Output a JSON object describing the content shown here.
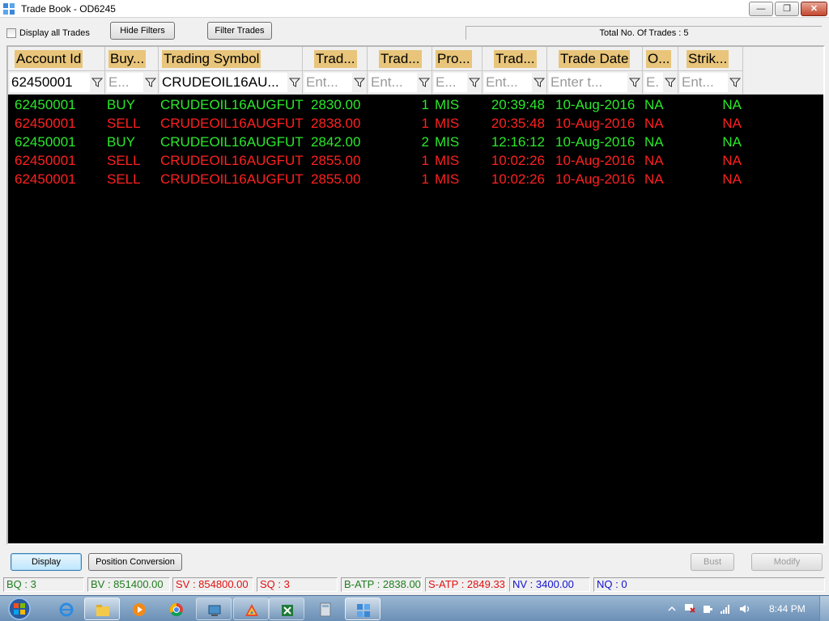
{
  "window": {
    "title": "Trade Book - OD6245"
  },
  "toolbar": {
    "display_all_label": "Display all Trades",
    "hide_filters_label": "Hide Filters",
    "filter_trades_label": "Filter Trades",
    "total_label": "Total No. Of Trades : 5"
  },
  "grid": {
    "columns": [
      {
        "label": "Account Id",
        "filter": "62450001"
      },
      {
        "label": "Buy...",
        "filter": "E..."
      },
      {
        "label": "Trading Symbol",
        "filter": "CRUDEOIL16AU..."
      },
      {
        "label": "Trad...",
        "filter": "Ent..."
      },
      {
        "label": "Trad...",
        "filter": "Ent..."
      },
      {
        "label": "Pro...",
        "filter": "E..."
      },
      {
        "label": "Trad...",
        "filter": "Ent..."
      },
      {
        "label": "Trade Date",
        "filter": "Enter t..."
      },
      {
        "label": "O...",
        "filter": "E."
      },
      {
        "label": "Strik...",
        "filter": "Ent..."
      }
    ],
    "rows": [
      {
        "account": "62450001",
        "side": "BUY",
        "symbol": "CRUDEOIL16AUGFUT",
        "price": "2830.00",
        "qty": "1",
        "product": "MIS",
        "time": "20:39:48",
        "date": "10-Aug-2016",
        "opt": "NA",
        "strike": "NA"
      },
      {
        "account": "62450001",
        "side": "SELL",
        "symbol": "CRUDEOIL16AUGFUT",
        "price": "2838.00",
        "qty": "1",
        "product": "MIS",
        "time": "20:35:48",
        "date": "10-Aug-2016",
        "opt": "NA",
        "strike": "NA"
      },
      {
        "account": "62450001",
        "side": "BUY",
        "symbol": "CRUDEOIL16AUGFUT",
        "price": "2842.00",
        "qty": "2",
        "product": "MIS",
        "time": "12:16:12",
        "date": "10-Aug-2016",
        "opt": "NA",
        "strike": "NA"
      },
      {
        "account": "62450001",
        "side": "SELL",
        "symbol": "CRUDEOIL16AUGFUT",
        "price": "2855.00",
        "qty": "1",
        "product": "MIS",
        "time": "10:02:26",
        "date": "10-Aug-2016",
        "opt": "NA",
        "strike": "NA"
      },
      {
        "account": "62450001",
        "side": "SELL",
        "symbol": "CRUDEOIL16AUGFUT",
        "price": "2855.00",
        "qty": "1",
        "product": "MIS",
        "time": "10:02:26",
        "date": "10-Aug-2016",
        "opt": "NA",
        "strike": "NA"
      }
    ]
  },
  "buttons": {
    "display": "Display",
    "position_conversion": "Position Conversion",
    "bust": "Bust",
    "modify": "Modify"
  },
  "status": {
    "bq": "BQ : 3",
    "bv": "BV : 851400.00",
    "sv": "SV : 854800.00",
    "sq": "SQ : 3",
    "batp": "B-ATP : 2838.00",
    "satp": "S-ATP : 2849.33",
    "nv": "NV : 3400.00",
    "nq": "NQ : 0"
  },
  "taskbar": {
    "clock": "8:44 PM",
    "items": [
      "internet-explorer-icon",
      "file-explorer-icon",
      "media-player-icon",
      "chrome-icon",
      "network-app-icon",
      "app-icon",
      "excel-icon",
      "calculator-icon",
      "trade-app-icon"
    ]
  },
  "colors": {
    "buy": "#2be82b",
    "sell": "#ff2020",
    "header": "#e8c57a",
    "grid_bg": "#000000",
    "status_green": "#1e7d1e",
    "status_red": "#e01010",
    "status_blue": "#1010d0"
  }
}
